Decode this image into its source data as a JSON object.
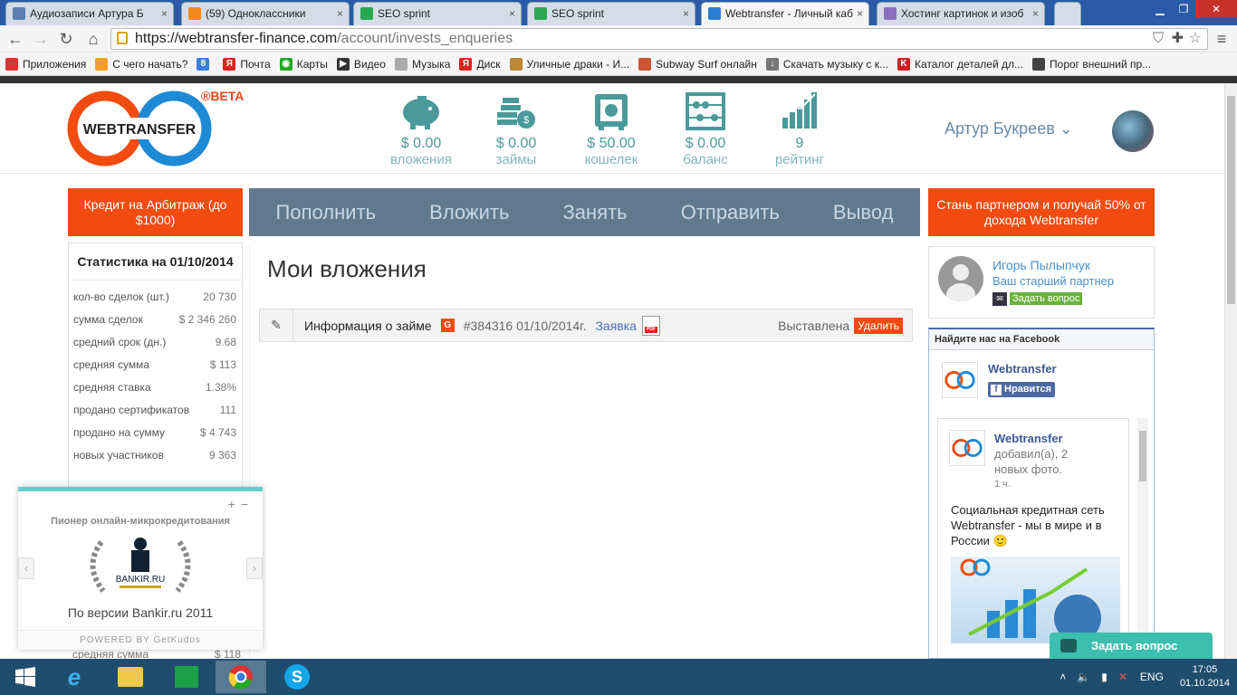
{
  "browser": {
    "tabs": [
      {
        "title": "Аудиозаписи Артура Б",
        "favicon": "play-icon",
        "color": "#5a7fb0"
      },
      {
        "title": "(59) Одноклассники",
        "favicon": "ok-icon",
        "color": "#f28b1e"
      },
      {
        "title": "SEO sprint",
        "favicon": "dollar-icon",
        "color": "#2aa852"
      },
      {
        "title": "SEO sprint",
        "favicon": "dollar-icon",
        "color": "#2aa852"
      },
      {
        "title": "Webtransfer - Личный каб",
        "favicon": "webtransfer-icon",
        "color": "#2a7fd4",
        "active": true
      },
      {
        "title": "Хостинг картинок и изоб",
        "favicon": "k-icon",
        "color": "#8a6fc0"
      }
    ],
    "url_host": "https://webtransfer-finance.com",
    "url_path": "/account/invests_enqueries",
    "bookmarks": [
      {
        "label": "Приложения",
        "color": "#d33"
      },
      {
        "label": "С чего начать?",
        "color": "#f2a02a"
      },
      {
        "label": "",
        "color": "#3a7ee0",
        "glyph": "8"
      },
      {
        "label": "Почта",
        "color": "#d22",
        "glyph": "Я"
      },
      {
        "label": "Карты",
        "color": "#2a2",
        "glyph": "◉"
      },
      {
        "label": "Видео",
        "color": "#333",
        "glyph": "▶"
      },
      {
        "label": "Музыка",
        "color": "#aaa",
        "glyph": ""
      },
      {
        "label": "Диск",
        "color": "#d22",
        "glyph": "Я"
      },
      {
        "label": "Уличные драки - И...",
        "color": "#b83",
        "glyph": ""
      },
      {
        "label": "Subway Surf онлайн",
        "color": "#c53",
        "glyph": ""
      },
      {
        "label": "Скачать музыку с к...",
        "color": "#777",
        "glyph": "↓"
      },
      {
        "label": "Каталог деталей дл...",
        "color": "#c22",
        "glyph": "K"
      },
      {
        "label": "Порог внешний пр...",
        "color": "#444",
        "glyph": ""
      }
    ]
  },
  "header": {
    "logo_text": "WEBTRANSFER",
    "beta": "®BETA",
    "stats": [
      {
        "value": "$ 0.00",
        "label": "вложения",
        "icon": "piggy-bank-icon"
      },
      {
        "value": "$ 0.00",
        "label": "займы",
        "icon": "coins-icon"
      },
      {
        "value": "$ 50.00",
        "label": "кошелек",
        "icon": "safe-icon"
      },
      {
        "value": "$ 0.00",
        "label": "баланс",
        "icon": "abacus-icon"
      },
      {
        "value": "9",
        "label": "рейтинг",
        "icon": "rating-chart-icon"
      }
    ],
    "user_name": "Артур Букреев"
  },
  "nav": {
    "credit": "Кредит на Арбитраж (до $1000)",
    "items": [
      "Пополнить",
      "Вложить",
      "Занять",
      "Отправить",
      "Вывод"
    ],
    "partner": "Стань партнером и получай 50% от дохода Webtransfer"
  },
  "stats_panel": {
    "title": "Статистика на 01/10/2014",
    "rows": [
      {
        "label": "кол-во сделок (шт.)",
        "value": "20 730"
      },
      {
        "label": "сумма сделок",
        "value": "$ 2 346 260"
      },
      {
        "label": "средний срок (дн.)",
        "value": "9.68"
      },
      {
        "label": "средняя сумма",
        "value": "$ 113"
      },
      {
        "label": "средняя ставка",
        "value": "1.38%"
      },
      {
        "label": "продано сертификатов",
        "value": "111"
      },
      {
        "label": "продано на сумму",
        "value": "$ 4 743"
      },
      {
        "label": "новых участников",
        "value": "9 363"
      }
    ],
    "peek_label": "средняя сумма",
    "peek_value": "$ 118"
  },
  "main": {
    "title": "Мои вложения",
    "row": {
      "info": "Информация о займе",
      "badge": "G",
      "number": "#384316 01/10/2014г.",
      "request": "Заявка",
      "status": "Выставлена",
      "delete": "Удалить"
    }
  },
  "mentor": {
    "name": "Игорь Пылыпчук",
    "role": "Ваш старший партнер",
    "ask": "Задать вопрос"
  },
  "facebook": {
    "heading": "Найдите нас на Facebook",
    "page_name": "Webtransfer",
    "like": "Нравится",
    "post_page": "Webtransfer",
    "post_action": "добавил(а), 2 новых фото.",
    "post_time": "1 ч.",
    "post_text": "Социальная кредитная сеть Webtransfer - мы в мире и в России 🙂"
  },
  "kudos": {
    "title": "Пионер онлайн-микрокредитования",
    "brand": "BANKIR.RU",
    "byline": "По версии Bankir.ru 2011",
    "powered": "POWERED BY GetKudos"
  },
  "chat": {
    "label": "Задать вопрос"
  },
  "taskbar": {
    "lang": "ENG",
    "time": "17:05",
    "date": "01.10.2014"
  }
}
